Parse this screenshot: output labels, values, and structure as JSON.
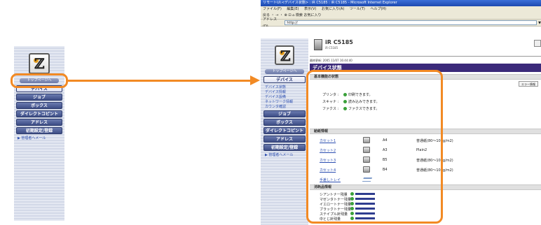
{
  "sidebar": {
    "title": "トップページへ",
    "items": [
      {
        "label": "デバイス",
        "selected": true
      },
      {
        "label": "ジョブ",
        "selected": false
      },
      {
        "label": "ボックス",
        "selected": false
      },
      {
        "label": "ダイレクトコピント",
        "selected": false
      },
      {
        "label": "アドレス",
        "selected": false
      },
      {
        "label": "初期設定/登録",
        "selected": false
      }
    ],
    "mail_link": "▶ 管理者へメール",
    "sub_links": [
      "デバイス状態",
      "デバイス情報",
      "デバイス設備",
      "ネットワーク情報",
      "カウンタ確認"
    ]
  },
  "browser": {
    "title": "リモートUI:<デバイス状態> : iR C5185 : iR C5185 - Microsoft Internet Explorer",
    "menus": [
      "ファイル(F)",
      "編集(E)",
      "表示(V)",
      "お気に入り(A)",
      "ツール(T)",
      "ヘルプ(H)"
    ],
    "toolbar": "戻る ・ → ・ ⊗ ⊡ ⌂   検索  お気に入り",
    "address_label": "アドレス(D)",
    "address_value": "http://",
    "go_label": "▼"
  },
  "device": {
    "name": "iR C5185",
    "sub": "iR C5185",
    "datetime": "最終更新: 2005 11/07 16:44:40",
    "page_title": "デバイス状態"
  },
  "basic_status": {
    "header": "基本機能の状態",
    "error_button": "エラー情報",
    "rows": [
      {
        "label": "プリンタ :",
        "value": "印刷できます。"
      },
      {
        "label": "スキャナ :",
        "value": "読み込みできます。"
      },
      {
        "label": "ファクス :",
        "value": "ファクスできます。"
      }
    ]
  },
  "paper": {
    "header": "給紙情報",
    "rows": [
      {
        "name": "カセット1",
        "size": "A4",
        "type": "普通紙(80～105g/m2)"
      },
      {
        "name": "カセット2",
        "size": "A3",
        "type": "Plain2"
      },
      {
        "name": "カセット3",
        "size": "B5",
        "type": "普通紙(80～105g/m2)"
      },
      {
        "name": "カセット4",
        "size": "B4",
        "type": "普通紙(80～105g/m2)"
      },
      {
        "name": "手差しトレイ",
        "size": "",
        "type": ""
      }
    ]
  },
  "consumables": {
    "header": "消耗品情報",
    "rows": [
      {
        "name": "シアントナー残量"
      },
      {
        "name": "マゼンタトナー残量"
      },
      {
        "name": "イエロートナー残量"
      },
      {
        "name": "ブラックトナー残量"
      },
      {
        "name": "ステイプル針残量"
      },
      {
        "name": "中とじ針残量"
      }
    ]
  },
  "colors": {
    "accent": "#f28a24",
    "menu": "#3c4c85",
    "title_bar": "#3b2a7a",
    "ok_green": "#3aa03a"
  }
}
